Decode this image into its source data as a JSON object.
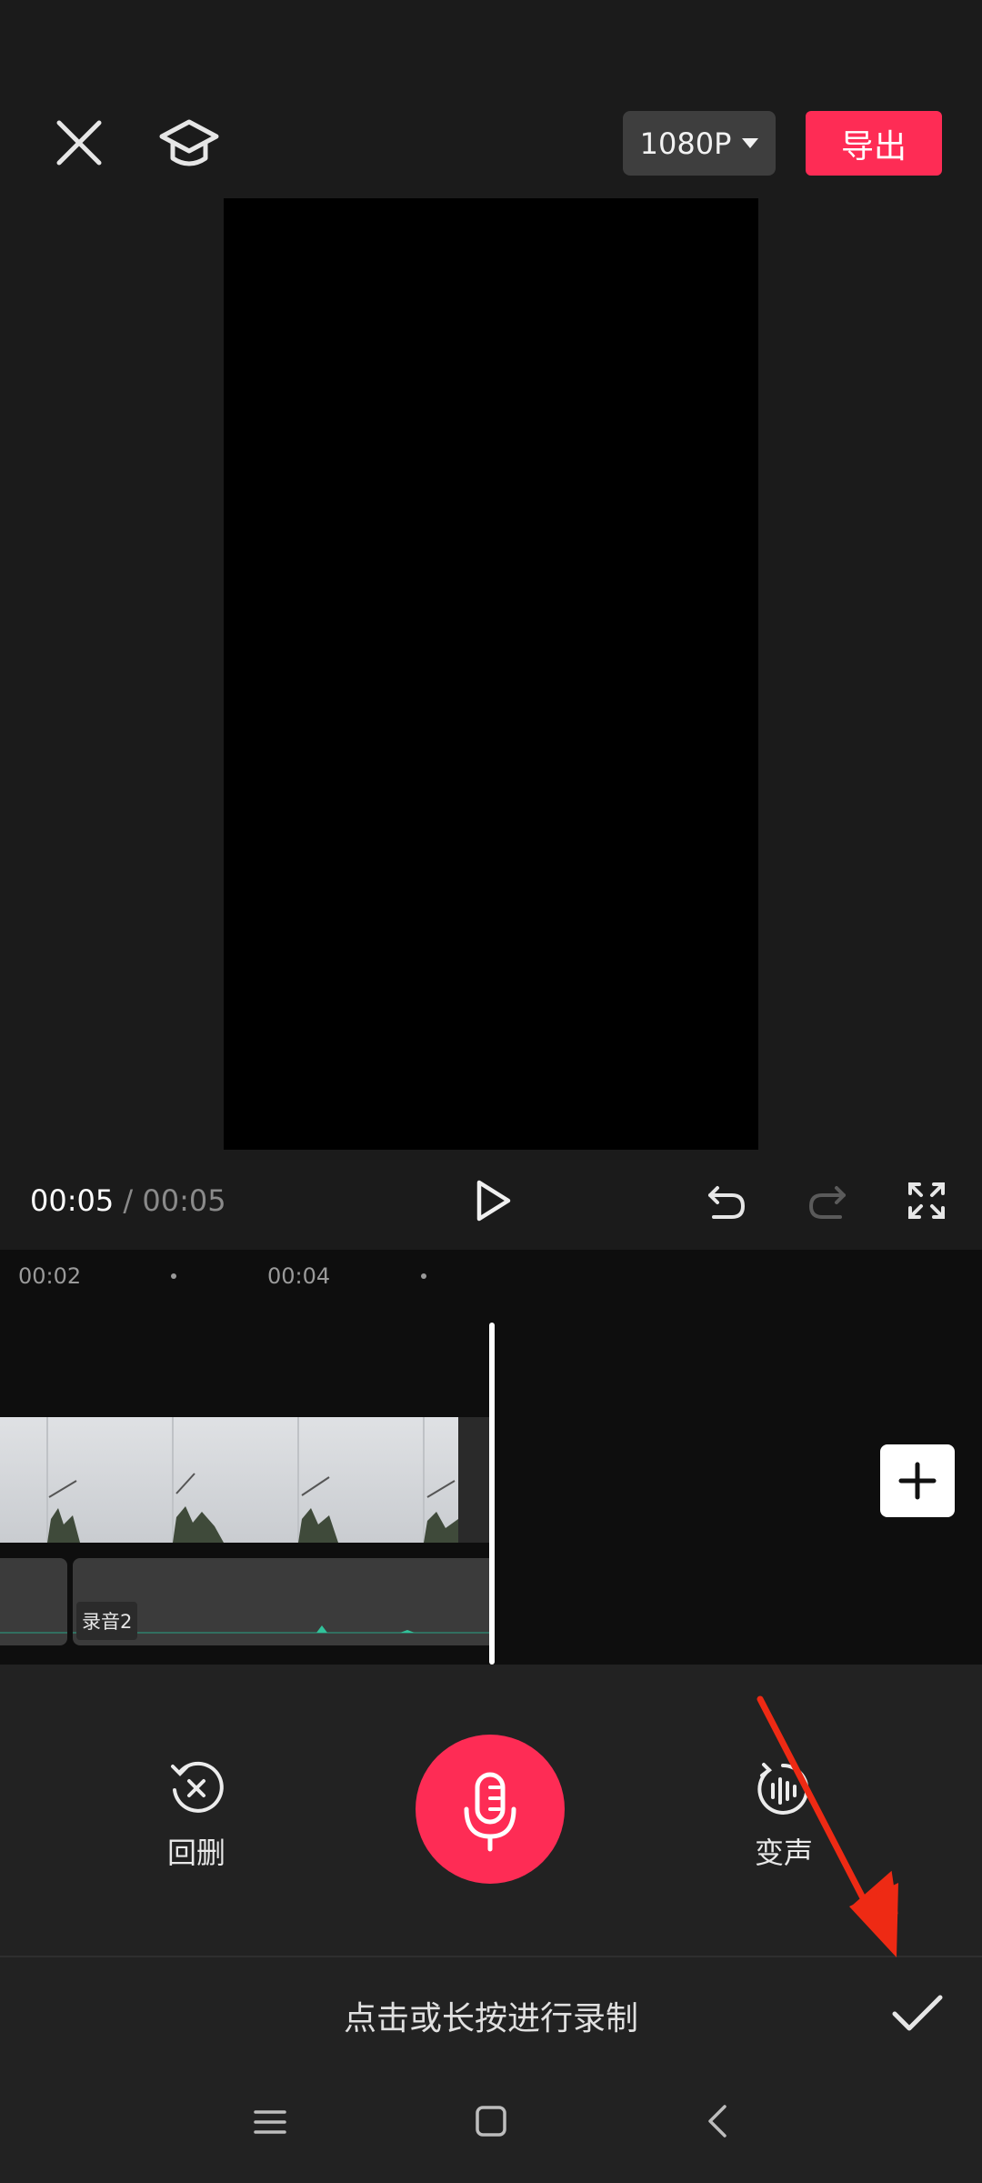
{
  "header": {
    "resolution": "1080P",
    "export_label": "导出"
  },
  "playback": {
    "current_time": "00:05",
    "separator": "/",
    "total_time": "00:05"
  },
  "timeline": {
    "ticks": [
      "00:02",
      "00:04"
    ],
    "audio_clip_label": "录音2"
  },
  "record_panel": {
    "delete_label": "回删",
    "voice_change_label": "变声",
    "hint": "点击或长按进行录制"
  },
  "colors": {
    "accent": "#fe2c55",
    "annotation_arrow": "#ee2a14"
  },
  "icons": [
    "close-icon",
    "tutorial-icon",
    "caret-down-icon",
    "play-icon",
    "undo-icon",
    "redo-icon",
    "fullscreen-icon",
    "plus-icon",
    "delete-back-icon",
    "microphone-icon",
    "voice-change-icon",
    "checkmark-icon",
    "menu-icon",
    "home-icon",
    "back-icon"
  ]
}
